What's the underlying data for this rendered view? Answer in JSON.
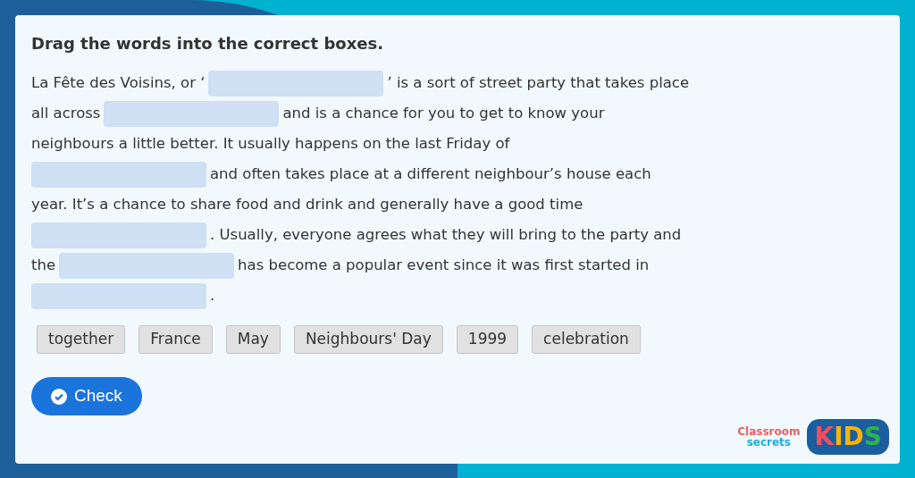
{
  "instruction": "Drag the words into the correct boxes.",
  "lines": [
    [
      {
        "kind": "text",
        "text": "La Fête des Voisins, or ‘"
      },
      {
        "kind": "blank"
      },
      {
        "kind": "text",
        "text": "’ is a sort of street party that takes place"
      }
    ],
    [
      {
        "kind": "text",
        "text": "all across"
      },
      {
        "kind": "blank"
      },
      {
        "kind": "text",
        "text": "and is a chance for you to get to know your"
      }
    ],
    [
      {
        "kind": "text",
        "text": "neighbours a little better. It usually happens on the last Friday of"
      }
    ],
    [
      {
        "kind": "blank"
      },
      {
        "kind": "text",
        "text": "and often takes place at a different neighbour’s house each"
      }
    ],
    [
      {
        "kind": "text",
        "text": "year. It’s a chance to share food and drink and generally have a good time"
      }
    ],
    [
      {
        "kind": "blank"
      },
      {
        "kind": "text",
        "text": ". Usually, everyone agrees what they will bring to the party and"
      }
    ],
    [
      {
        "kind": "text",
        "text": "the"
      },
      {
        "kind": "blank"
      },
      {
        "kind": "text",
        "text": "has become a popular event since it was first started in"
      }
    ],
    [
      {
        "kind": "blank"
      },
      {
        "kind": "text",
        "text": "."
      }
    ]
  ],
  "words": [
    "together",
    "France",
    "May",
    "Neighbours' Day",
    "1999",
    "celebration"
  ],
  "check_button": "Check",
  "logo": {
    "line1": "Classroom",
    "line2": "secrets",
    "badge": "KIDS"
  }
}
